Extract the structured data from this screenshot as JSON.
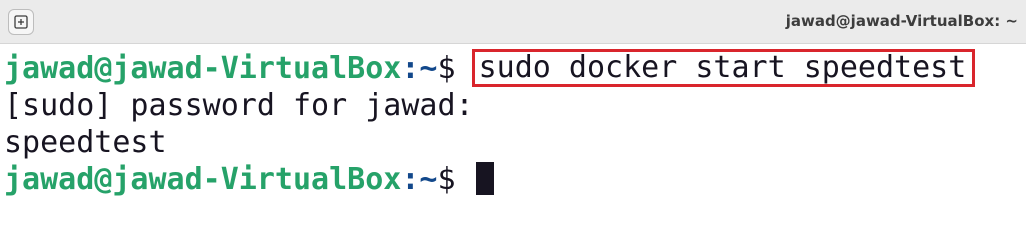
{
  "window": {
    "title": "jawad@jawad-VirtualBox: ~",
    "new_tab_icon": "new-tab-icon"
  },
  "terminal": {
    "lines": [
      {
        "user_host": "jawad@jawad-VirtualBox",
        "path": ":~",
        "symbol": "$ ",
        "command": "sudo docker start speedtest"
      },
      {
        "text": "[sudo] password for jawad:"
      },
      {
        "text": "speedtest"
      },
      {
        "user_host": "jawad@jawad-VirtualBox",
        "path": ":~",
        "symbol": "$ "
      }
    ],
    "colors": {
      "user_host": "#26a269",
      "path": "#12488b",
      "text": "#171421",
      "highlight_box": "#d9252c"
    }
  }
}
